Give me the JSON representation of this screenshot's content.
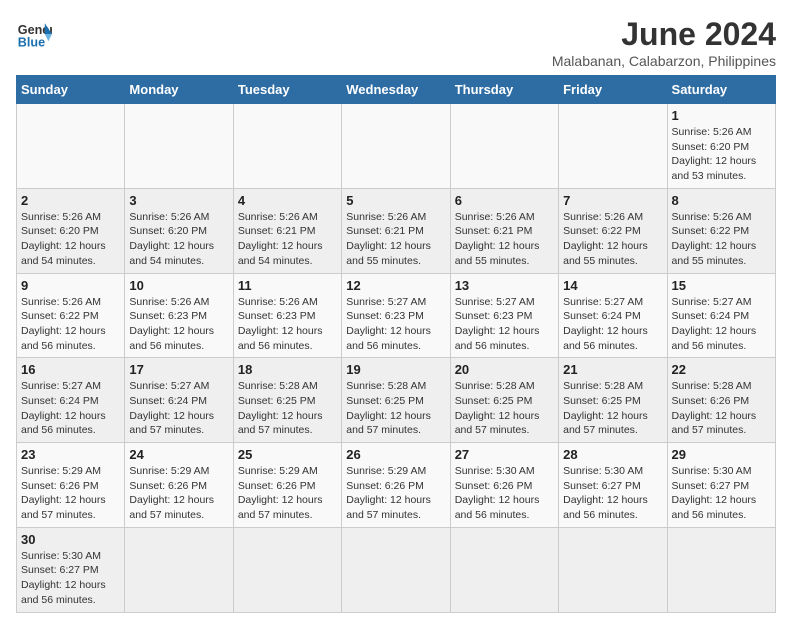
{
  "logo": {
    "text_general": "General",
    "text_blue": "Blue"
  },
  "title": {
    "month_year": "June 2024",
    "location": "Malabanan, Calabarzon, Philippines"
  },
  "days_of_week": [
    "Sunday",
    "Monday",
    "Tuesday",
    "Wednesday",
    "Thursday",
    "Friday",
    "Saturday"
  ],
  "weeks": [
    [
      {
        "day": "",
        "info": ""
      },
      {
        "day": "",
        "info": ""
      },
      {
        "day": "",
        "info": ""
      },
      {
        "day": "",
        "info": ""
      },
      {
        "day": "",
        "info": ""
      },
      {
        "day": "",
        "info": ""
      },
      {
        "day": "1",
        "info": "Sunrise: 5:26 AM\nSunset: 6:20 PM\nDaylight: 12 hours and 53 minutes."
      }
    ],
    [
      {
        "day": "2",
        "info": "Sunrise: 5:26 AM\nSunset: 6:20 PM\nDaylight: 12 hours and 54 minutes."
      },
      {
        "day": "3",
        "info": "Sunrise: 5:26 AM\nSunset: 6:20 PM\nDaylight: 12 hours and 54 minutes."
      },
      {
        "day": "4",
        "info": "Sunrise: 5:26 AM\nSunset: 6:21 PM\nDaylight: 12 hours and 54 minutes."
      },
      {
        "day": "5",
        "info": "Sunrise: 5:26 AM\nSunset: 6:21 PM\nDaylight: 12 hours and 55 minutes."
      },
      {
        "day": "6",
        "info": "Sunrise: 5:26 AM\nSunset: 6:21 PM\nDaylight: 12 hours and 55 minutes."
      },
      {
        "day": "7",
        "info": "Sunrise: 5:26 AM\nSunset: 6:22 PM\nDaylight: 12 hours and 55 minutes."
      },
      {
        "day": "8",
        "info": "Sunrise: 5:26 AM\nSunset: 6:22 PM\nDaylight: 12 hours and 55 minutes."
      }
    ],
    [
      {
        "day": "9",
        "info": "Sunrise: 5:26 AM\nSunset: 6:22 PM\nDaylight: 12 hours and 56 minutes."
      },
      {
        "day": "10",
        "info": "Sunrise: 5:26 AM\nSunset: 6:23 PM\nDaylight: 12 hours and 56 minutes."
      },
      {
        "day": "11",
        "info": "Sunrise: 5:26 AM\nSunset: 6:23 PM\nDaylight: 12 hours and 56 minutes."
      },
      {
        "day": "12",
        "info": "Sunrise: 5:27 AM\nSunset: 6:23 PM\nDaylight: 12 hours and 56 minutes."
      },
      {
        "day": "13",
        "info": "Sunrise: 5:27 AM\nSunset: 6:23 PM\nDaylight: 12 hours and 56 minutes."
      },
      {
        "day": "14",
        "info": "Sunrise: 5:27 AM\nSunset: 6:24 PM\nDaylight: 12 hours and 56 minutes."
      },
      {
        "day": "15",
        "info": "Sunrise: 5:27 AM\nSunset: 6:24 PM\nDaylight: 12 hours and 56 minutes."
      }
    ],
    [
      {
        "day": "16",
        "info": "Sunrise: 5:27 AM\nSunset: 6:24 PM\nDaylight: 12 hours and 56 minutes."
      },
      {
        "day": "17",
        "info": "Sunrise: 5:27 AM\nSunset: 6:24 PM\nDaylight: 12 hours and 57 minutes."
      },
      {
        "day": "18",
        "info": "Sunrise: 5:28 AM\nSunset: 6:25 PM\nDaylight: 12 hours and 57 minutes."
      },
      {
        "day": "19",
        "info": "Sunrise: 5:28 AM\nSunset: 6:25 PM\nDaylight: 12 hours and 57 minutes."
      },
      {
        "day": "20",
        "info": "Sunrise: 5:28 AM\nSunset: 6:25 PM\nDaylight: 12 hours and 57 minutes."
      },
      {
        "day": "21",
        "info": "Sunrise: 5:28 AM\nSunset: 6:25 PM\nDaylight: 12 hours and 57 minutes."
      },
      {
        "day": "22",
        "info": "Sunrise: 5:28 AM\nSunset: 6:26 PM\nDaylight: 12 hours and 57 minutes."
      }
    ],
    [
      {
        "day": "23",
        "info": "Sunrise: 5:29 AM\nSunset: 6:26 PM\nDaylight: 12 hours and 57 minutes."
      },
      {
        "day": "24",
        "info": "Sunrise: 5:29 AM\nSunset: 6:26 PM\nDaylight: 12 hours and 57 minutes."
      },
      {
        "day": "25",
        "info": "Sunrise: 5:29 AM\nSunset: 6:26 PM\nDaylight: 12 hours and 57 minutes."
      },
      {
        "day": "26",
        "info": "Sunrise: 5:29 AM\nSunset: 6:26 PM\nDaylight: 12 hours and 57 minutes."
      },
      {
        "day": "27",
        "info": "Sunrise: 5:30 AM\nSunset: 6:26 PM\nDaylight: 12 hours and 56 minutes."
      },
      {
        "day": "28",
        "info": "Sunrise: 5:30 AM\nSunset: 6:27 PM\nDaylight: 12 hours and 56 minutes."
      },
      {
        "day": "29",
        "info": "Sunrise: 5:30 AM\nSunset: 6:27 PM\nDaylight: 12 hours and 56 minutes."
      }
    ],
    [
      {
        "day": "30",
        "info": "Sunrise: 5:30 AM\nSunset: 6:27 PM\nDaylight: 12 hours and 56 minutes."
      },
      {
        "day": "",
        "info": ""
      },
      {
        "day": "",
        "info": ""
      },
      {
        "day": "",
        "info": ""
      },
      {
        "day": "",
        "info": ""
      },
      {
        "day": "",
        "info": ""
      },
      {
        "day": "",
        "info": ""
      }
    ]
  ]
}
